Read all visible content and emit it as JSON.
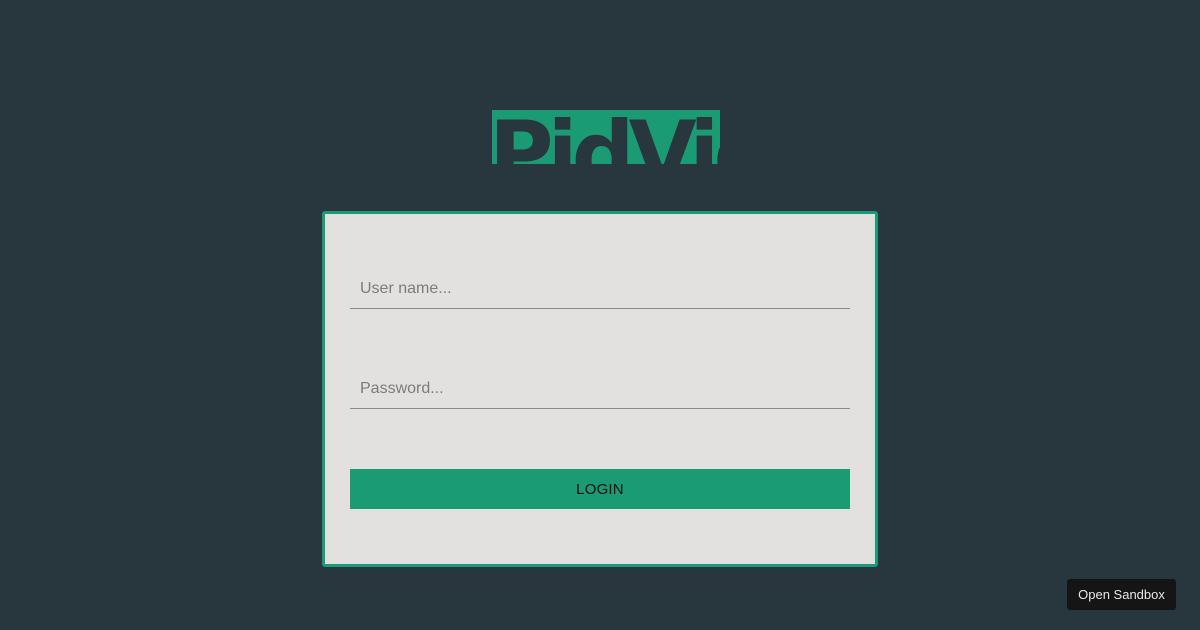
{
  "logo": {
    "text": "PidVid"
  },
  "login_form": {
    "username_placeholder": "User name...",
    "password_placeholder": "Password...",
    "login_label": "LOGIN"
  },
  "sandbox": {
    "label": "Open Sandbox"
  },
  "colors": {
    "background": "#27373d",
    "accent": "#1b9b73",
    "card": "#e3e0e0"
  }
}
